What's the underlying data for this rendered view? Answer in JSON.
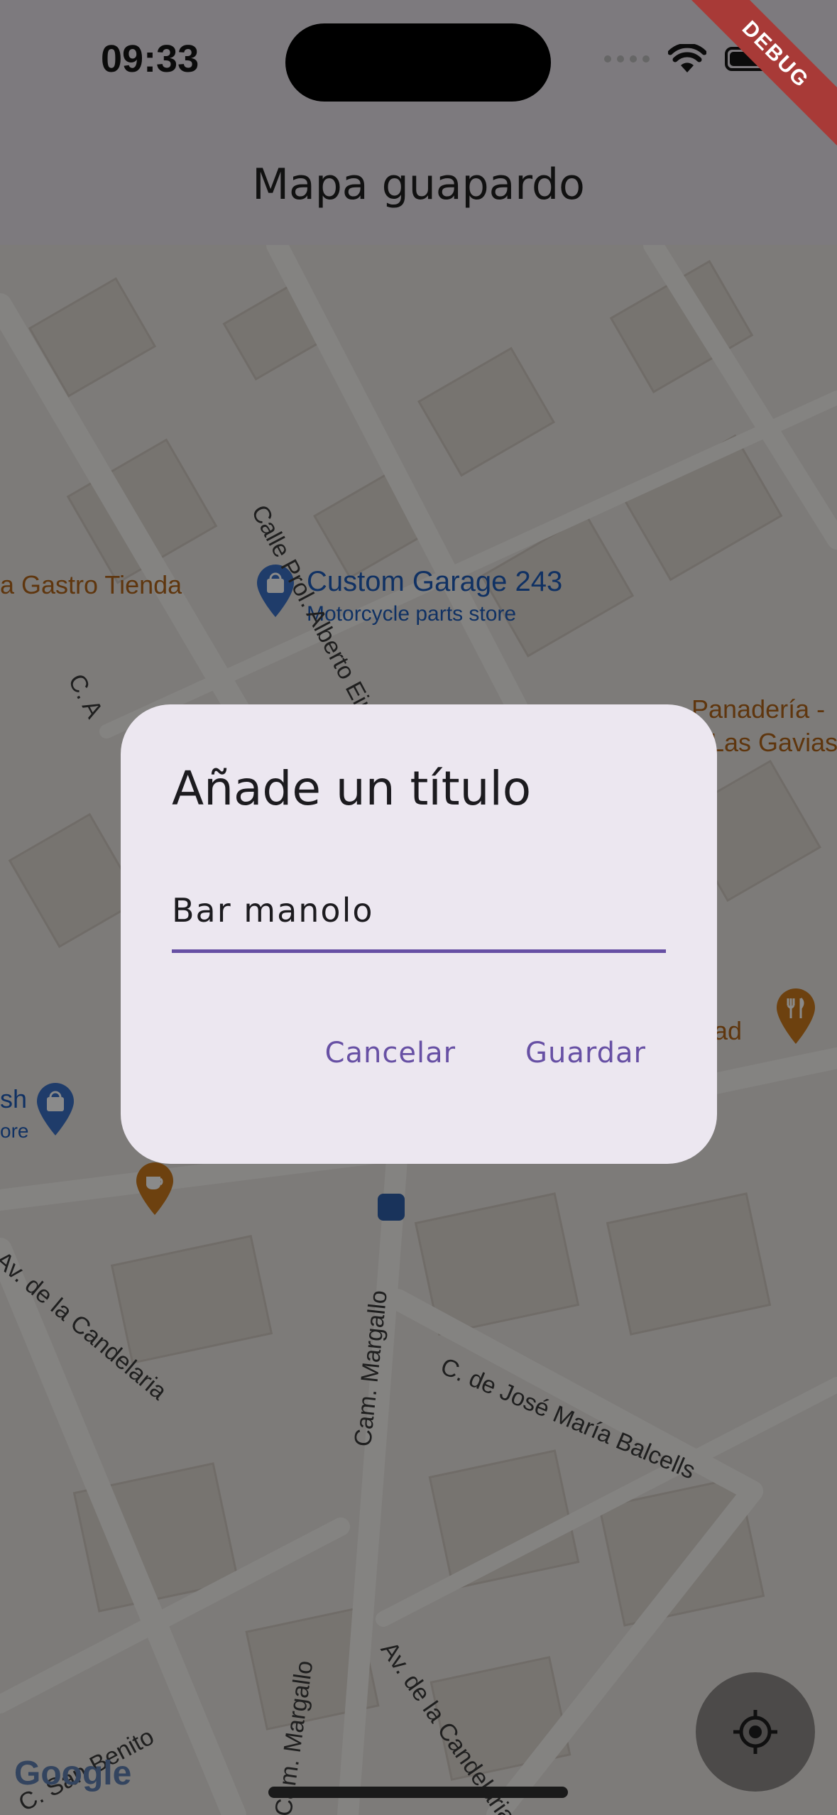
{
  "status_bar": {
    "time": "09:33",
    "debug_badge": "DEBUG"
  },
  "app_bar": {
    "title": "Mapa guapardo"
  },
  "map": {
    "pois": [
      {
        "name": "a Gastro Tienda",
        "color": "#b0641a"
      },
      {
        "name": "Custom Garage 243",
        "subtitle": "Motorcycle parts store",
        "color": "#1f5bb8",
        "icon": "shopping-bag-icon"
      },
      {
        "name": "Panadería - Las Gavias",
        "line1": "Panadería -",
        "line2": "Las Gavias",
        "color": "#b0641a"
      },
      {
        "name": "ad",
        "color": "#b0641a",
        "icon": "restaurant-icon"
      },
      {
        "name": "sh / ore",
        "line1": "sh",
        "line2": "ore",
        "color": "#1f5bb8",
        "icon": "shopping-bag-icon"
      }
    ],
    "streets": [
      "Calle Prol. Alberto Einstein",
      "C. A",
      "Av. de la Candelaria",
      "Cam. Margallo",
      "C. de José María Balcells",
      "C. San Benito",
      "Av. de la Candelaria",
      "Cam. Margallo"
    ],
    "attribution": "Google"
  },
  "dialog": {
    "title": "Añade un título",
    "field_value": "Bar manolo",
    "cancel_label": "Cancelar",
    "save_label": "Guardar",
    "accent_color": "#6750a4"
  },
  "fab": {
    "icon": "my-location-icon"
  }
}
